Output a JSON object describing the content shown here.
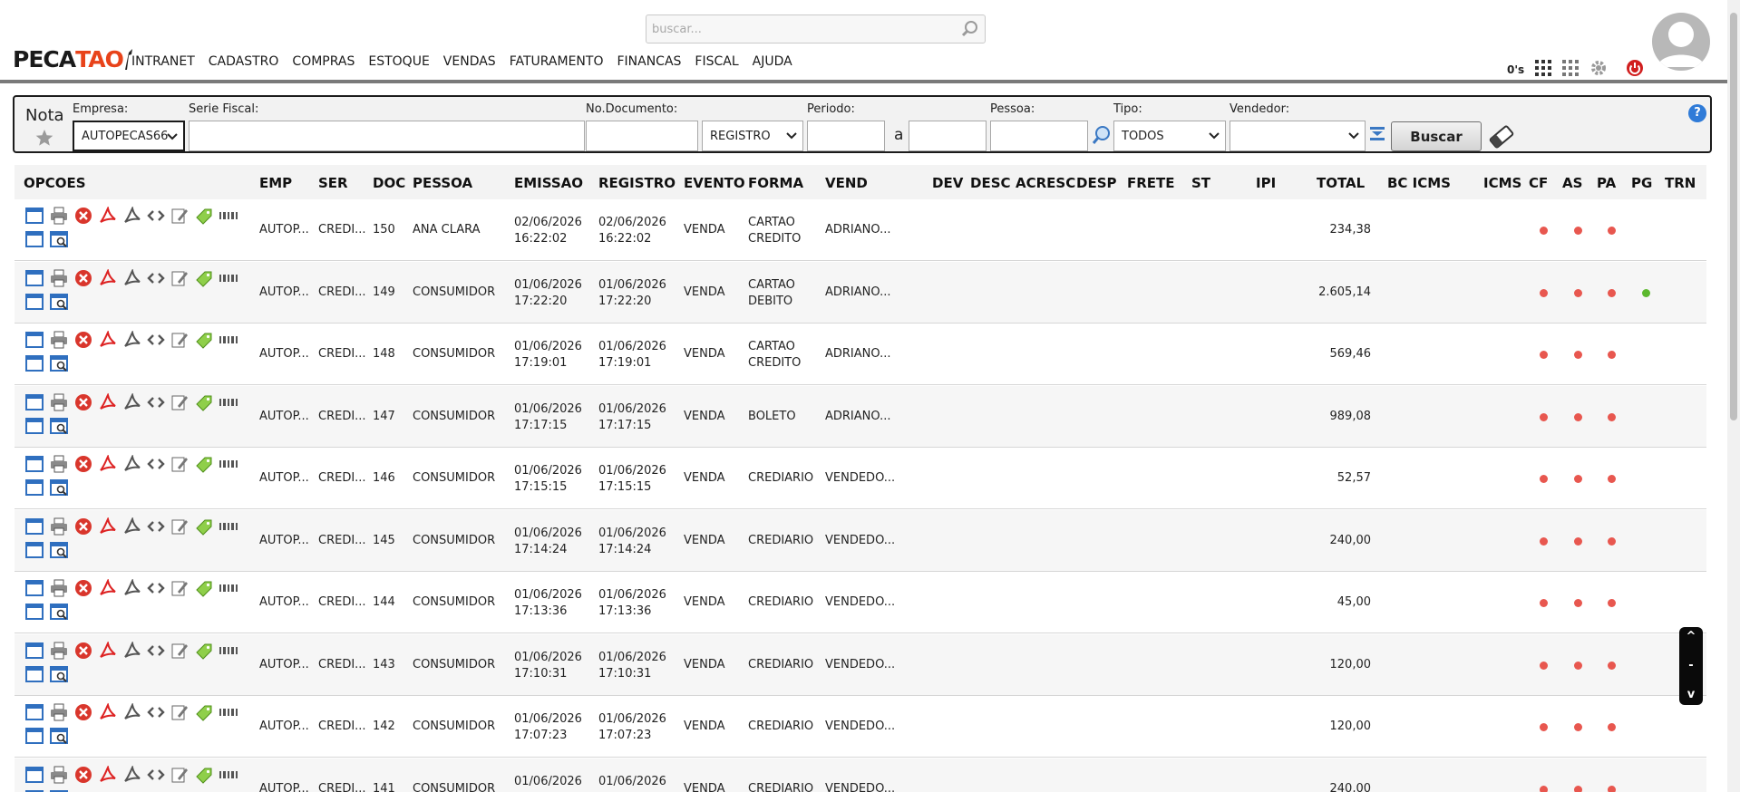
{
  "header": {
    "search_placeholder": "buscar...",
    "logo_text_a": "PECA",
    "logo_text_b": "TAO",
    "menu": [
      "INTRANET",
      "CADASTRO",
      "COMPRAS",
      "ESTOQUE",
      "VENDAS",
      "FATURAMENTO",
      "FINANCAS",
      "FISCAL",
      "AJUDA"
    ],
    "counter": "0's",
    "icons": [
      "grid-icon",
      "apps-icon",
      "gear-icon",
      "power-icon"
    ]
  },
  "filters": {
    "title": "Nota",
    "empresa_label": "Empresa:",
    "empresa_value": "AUTOPECAS66",
    "serie_label": "Serie Fiscal:",
    "serie_value": "",
    "doc_label": "No.Documento:",
    "doc_value": "",
    "data_tipo": "REGISTRO",
    "periodo_label": "Periodo:",
    "periodo_from": "",
    "periodo_sep": "a",
    "periodo_to": "",
    "pessoa_label": "Pessoa:",
    "pessoa_value": "",
    "tipo_label": "Tipo:",
    "tipo_value": "TODOS",
    "vendedor_label": "Vendedor:",
    "vendedor_value": "",
    "buscar_label": "Buscar",
    "help_label": "?"
  },
  "table": {
    "headers": {
      "opcoes": "OPCOES",
      "emp": "EMP",
      "ser": "SER",
      "doc": "DOC",
      "pessoa": "PESSOA",
      "emissao": "EMISSAO",
      "registro": "REGISTRO",
      "evento": "EVENTO",
      "forma": "FORMA",
      "vend": "VEND",
      "dev": "DEV",
      "desc": "DESC",
      "acresc": "ACRESC",
      "desp": "DESP",
      "frete": "FRETE",
      "st": "ST",
      "ipi": "IPI",
      "total": "TOTAL",
      "bc_icms": "BC ICMS",
      "icms": "ICMS",
      "cf": "CF",
      "as": "AS",
      "pa": "PA",
      "pg": "PG",
      "trn": "TRN"
    },
    "rows": [
      {
        "emp": "AUTOP...",
        "ser": "CREDI...",
        "doc": "150",
        "pessoa": "ANA CLARA",
        "emissao_d": "02/06/2026",
        "emissao_t": "16:22:02",
        "registro_d": "02/06/2026",
        "registro_t": "16:22:02",
        "evento": "VENDA",
        "forma_1": "CARTAO",
        "forma_2": "CREDITO",
        "vend": "ADRIANO...",
        "total": "234,38",
        "pg": false
      },
      {
        "emp": "AUTOP...",
        "ser": "CREDI...",
        "doc": "149",
        "pessoa": "CONSUMIDOR",
        "emissao_d": "01/06/2026",
        "emissao_t": "17:22:20",
        "registro_d": "01/06/2026",
        "registro_t": "17:22:20",
        "evento": "VENDA",
        "forma_1": "CARTAO",
        "forma_2": "DEBITO",
        "vend": "ADRIANO...",
        "total": "2.605,14",
        "pg": true
      },
      {
        "emp": "AUTOP...",
        "ser": "CREDI...",
        "doc": "148",
        "pessoa": "CONSUMIDOR",
        "emissao_d": "01/06/2026",
        "emissao_t": "17:19:01",
        "registro_d": "01/06/2026",
        "registro_t": "17:19:01",
        "evento": "VENDA",
        "forma_1": "CARTAO",
        "forma_2": "CREDITO",
        "vend": "ADRIANO...",
        "total": "569,46",
        "pg": false
      },
      {
        "emp": "AUTOP...",
        "ser": "CREDI...",
        "doc": "147",
        "pessoa": "CONSUMIDOR",
        "emissao_d": "01/06/2026",
        "emissao_t": "17:17:15",
        "registro_d": "01/06/2026",
        "registro_t": "17:17:15",
        "evento": "VENDA",
        "forma_1": "BOLETO",
        "forma_2": "",
        "vend": "ADRIANO...",
        "total": "989,08",
        "pg": false
      },
      {
        "emp": "AUTOP...",
        "ser": "CREDI...",
        "doc": "146",
        "pessoa": "CONSUMIDOR",
        "emissao_d": "01/06/2026",
        "emissao_t": "17:15:15",
        "registro_d": "01/06/2026",
        "registro_t": "17:15:15",
        "evento": "VENDA",
        "forma_1": "CREDIARIO",
        "forma_2": "",
        "vend": "VENDEDO...",
        "total": "52,57",
        "pg": false
      },
      {
        "emp": "AUTOP...",
        "ser": "CREDI...",
        "doc": "145",
        "pessoa": "CONSUMIDOR",
        "emissao_d": "01/06/2026",
        "emissao_t": "17:14:24",
        "registro_d": "01/06/2026",
        "registro_t": "17:14:24",
        "evento": "VENDA",
        "forma_1": "CREDIARIO",
        "forma_2": "",
        "vend": "VENDEDO...",
        "total": "240,00",
        "pg": false
      },
      {
        "emp": "AUTOP...",
        "ser": "CREDI...",
        "doc": "144",
        "pessoa": "CONSUMIDOR",
        "emissao_d": "01/06/2026",
        "emissao_t": "17:13:36",
        "registro_d": "01/06/2026",
        "registro_t": "17:13:36",
        "evento": "VENDA",
        "forma_1": "CREDIARIO",
        "forma_2": "",
        "vend": "VENDEDO...",
        "total": "45,00",
        "pg": false
      },
      {
        "emp": "AUTOP...",
        "ser": "CREDI...",
        "doc": "143",
        "pessoa": "CONSUMIDOR",
        "emissao_d": "01/06/2026",
        "emissao_t": "17:10:31",
        "registro_d": "01/06/2026",
        "registro_t": "17:10:31",
        "evento": "VENDA",
        "forma_1": "CREDIARIO",
        "forma_2": "",
        "vend": "VENDEDO...",
        "total": "120,00",
        "pg": false
      },
      {
        "emp": "AUTOP...",
        "ser": "CREDI...",
        "doc": "142",
        "pessoa": "CONSUMIDOR",
        "emissao_d": "01/06/2026",
        "emissao_t": "17:07:23",
        "registro_d": "01/06/2026",
        "registro_t": "17:07:23",
        "evento": "VENDA",
        "forma_1": "CREDIARIO",
        "forma_2": "",
        "vend": "VENDEDO...",
        "total": "120,00",
        "pg": false
      },
      {
        "emp": "AUTOP...",
        "ser": "CREDI...",
        "doc": "141",
        "pessoa": "CONSUMIDOR",
        "emissao_d": "01/06/2026",
        "emissao_t": "",
        "registro_d": "01/06/2026",
        "registro_t": "",
        "evento": "VENDA",
        "forma_1": "CREDIARIO",
        "forma_2": "",
        "vend": "VENDEDO...",
        "total": "240,00",
        "pg": false
      }
    ],
    "row_icons": [
      "window-icon",
      "print-icon",
      "cancel-icon",
      "pdf-icon",
      "pdf-outline-icon",
      "code-icon",
      "edit-icon",
      "tag-icon",
      "barcode-icon",
      "window-icon",
      "preview-icon"
    ],
    "status_colors": {
      "red": "#e8574f",
      "green": "#5cb82e"
    }
  },
  "scroll_ctrl": {
    "up": "^",
    "mid": "-",
    "down": "v"
  }
}
